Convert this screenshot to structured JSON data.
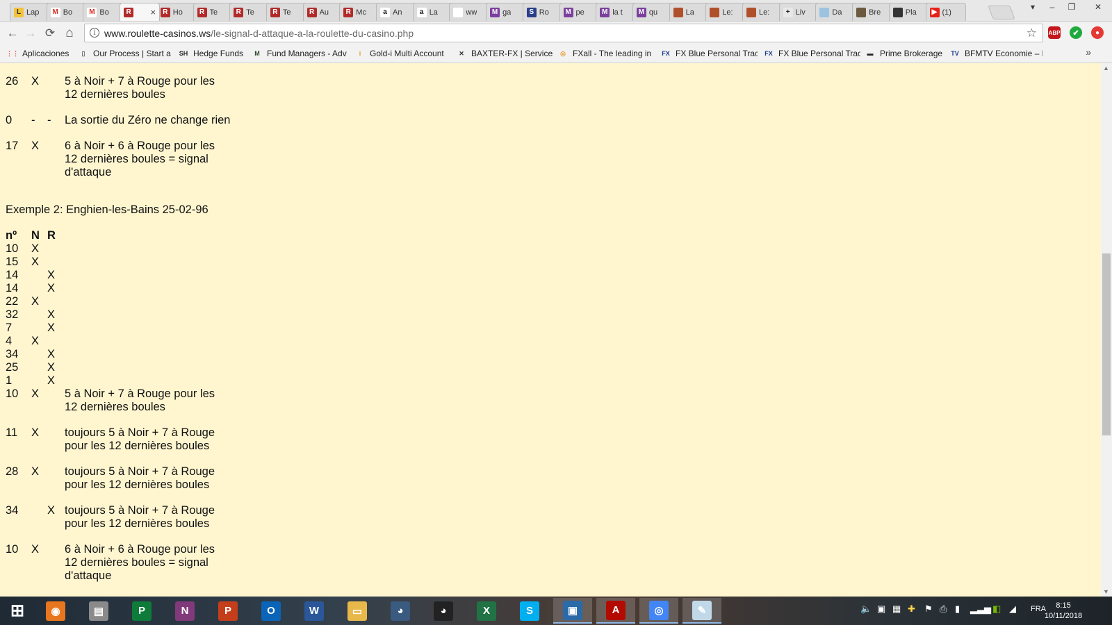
{
  "tabs": [
    {
      "label": "Lap",
      "fav": "L",
      "color": "#f2c33a",
      "text": "#333"
    },
    {
      "label": "Bo",
      "fav": "M",
      "color": "#ffffff",
      "text": "#d93025"
    },
    {
      "label": "Bo",
      "fav": "M",
      "color": "#ffffff",
      "text": "#d93025"
    },
    {
      "label": "",
      "fav": "R",
      "color": "#b22b2b",
      "text": "#fff",
      "active": true,
      "close": "×"
    },
    {
      "label": "Ho",
      "fav": "R",
      "color": "#b22b2b",
      "text": "#fff"
    },
    {
      "label": "Te",
      "fav": "R",
      "color": "#b22b2b",
      "text": "#fff"
    },
    {
      "label": "Te",
      "fav": "R",
      "color": "#b22b2b",
      "text": "#fff"
    },
    {
      "label": "Te",
      "fav": "R",
      "color": "#b22b2b",
      "text": "#fff"
    },
    {
      "label": "Au",
      "fav": "R",
      "color": "#b22b2b",
      "text": "#fff"
    },
    {
      "label": "Mc",
      "fav": "R",
      "color": "#b22b2b",
      "text": "#fff"
    },
    {
      "label": "An",
      "fav": "a",
      "color": "#ffffff",
      "text": "#111"
    },
    {
      "label": "La",
      "fav": "a",
      "color": "#ffffff",
      "text": "#111"
    },
    {
      "label": "ww",
      "fav": "",
      "color": "#ffffff",
      "text": "#111"
    },
    {
      "label": "ga",
      "fav": "M",
      "color": "#7b3f9e",
      "text": "#fff"
    },
    {
      "label": "Ro",
      "fav": "S",
      "color": "#2b3e8c",
      "text": "#fff"
    },
    {
      "label": "pe",
      "fav": "M",
      "color": "#7b3f9e",
      "text": "#fff"
    },
    {
      "label": "la t",
      "fav": "M",
      "color": "#7b3f9e",
      "text": "#fff"
    },
    {
      "label": "qu",
      "fav": "M",
      "color": "#7b3f9e",
      "text": "#fff"
    },
    {
      "label": "La",
      "fav": "",
      "color": "#b0502a",
      "text": "#fff"
    },
    {
      "label": "Le:",
      "fav": "",
      "color": "#b0502a",
      "text": "#fff"
    },
    {
      "label": "Le:",
      "fav": "",
      "color": "#b0502a",
      "text": "#fff"
    },
    {
      "label": "Liv",
      "fav": "+",
      "color": "#e8e8e8",
      "text": "#222"
    },
    {
      "label": "Da",
      "fav": "",
      "color": "#9cc3e0",
      "text": "#fff"
    },
    {
      "label": "Bre",
      "fav": "",
      "color": "#6b5a3e",
      "text": "#fff"
    },
    {
      "label": "Pla",
      "fav": "",
      "color": "#333333",
      "text": "#fff"
    },
    {
      "label": "(1)",
      "fav": "▶",
      "color": "#e62117",
      "text": "#fff"
    }
  ],
  "window": {
    "minimize": "–",
    "restore": "❐",
    "close": "✕",
    "user": "▾"
  },
  "toolbar": {
    "back": "←",
    "forward": "→",
    "reload": "⟳",
    "home": "⌂",
    "info": "i",
    "url_host": "www.roulette-casinos.ws",
    "url_path": "/le-signal-d-attaque-a-la-roulette-du-casino.php",
    "star": "☆",
    "ext_abp": "ABP",
    "ext_check": "✔",
    "ext_red": "●",
    "menu": "⋮"
  },
  "bookmarks": [
    {
      "label": "Aplicaciones",
      "ico": "⋮⋮",
      "color": "#e04a2e"
    },
    {
      "label": "Our Process | Start a",
      "ico": "▯",
      "color": "#666"
    },
    {
      "label": "Hedge Funds",
      "ico": "SH",
      "color": "#222"
    },
    {
      "label": "Fund Managers - Adv",
      "ico": "M",
      "color": "#2c4a2c"
    },
    {
      "label": "Gold-i Multi Account",
      "ico": "i",
      "color": "#d9a520"
    },
    {
      "label": "BAXTER-FX | Services",
      "ico": "✕",
      "color": "#333"
    },
    {
      "label": "FXall - The leading in",
      "ico": "◎",
      "color": "#e89a3c"
    },
    {
      "label": "FX Blue Personal Trac",
      "ico": "FX",
      "color": "#1a3a8c"
    },
    {
      "label": "FX Blue Personal Trac",
      "ico": "FX",
      "color": "#1a3a8c"
    },
    {
      "label": "Prime Brokerage",
      "ico": "▬",
      "color": "#222"
    },
    {
      "label": "BFMTV Economie – la",
      "ico": "TV",
      "color": "#1a3a8c"
    }
  ],
  "bookmarks_more": "»",
  "content": {
    "top_rows": [
      {
        "n": "26",
        "b": "X",
        "r": "",
        "note": [
          "5 à Noir + 7 à Rouge pour les",
          "12 dernières boules"
        ]
      },
      {
        "n": "0",
        "b": "-",
        "r": "-",
        "note": [
          "La sortie du Zéro ne change rien"
        ]
      },
      {
        "n": "17",
        "b": "X",
        "r": "",
        "note": [
          "6 à Noir + 6 à Rouge pour les",
          "12 dernières boules = signal",
          "d'attaque"
        ]
      }
    ],
    "example_title": "Exemple 2: Enghien-les-Bains 25-02-96",
    "headers": {
      "n": "nº",
      "b": "N",
      "r": "R"
    },
    "rows": [
      {
        "n": "10",
        "b": "X",
        "r": ""
      },
      {
        "n": "15",
        "b": "X",
        "r": ""
      },
      {
        "n": "14",
        "b": "",
        "r": "X"
      },
      {
        "n": "14",
        "b": "",
        "r": "X"
      },
      {
        "n": "22",
        "b": "X",
        "r": ""
      },
      {
        "n": "32",
        "b": "",
        "r": "X"
      },
      {
        "n": "7",
        "b": "",
        "r": "X"
      },
      {
        "n": "4",
        "b": "X",
        "r": ""
      },
      {
        "n": "34",
        "b": "",
        "r": "X"
      },
      {
        "n": "25",
        "b": "",
        "r": "X"
      },
      {
        "n": "1",
        "b": "",
        "r": "X"
      }
    ],
    "note_rows": [
      {
        "n": "10",
        "b": "X",
        "r": "",
        "note": [
          "5 à Noir + 7 à Rouge pour les",
          "12 dernières boules"
        ]
      },
      {
        "n": "11",
        "b": "X",
        "r": "",
        "note": [
          "toujours 5 à Noir + 7 à Rouge",
          "pour les 12 dernières boules"
        ]
      },
      {
        "n": "28",
        "b": "X",
        "r": "",
        "note": [
          "toujours 5 à Noir + 7 à Rouge",
          "pour les 12 dernières boules"
        ]
      },
      {
        "n": "34",
        "b": "",
        "r": "X",
        "note": [
          "toujours 5 à Noir + 7 à Rouge",
          "pour les 12 dernières boules"
        ]
      },
      {
        "n": "10",
        "b": "X",
        "r": "",
        "note": [
          "6 à Noir + 6 à Rouge pour les",
          "12 dernières boules = signal",
          "d'attaque"
        ]
      }
    ]
  },
  "taskbar": {
    "apps": [
      {
        "name": "start",
        "glyph": "⊞",
        "color": "transparent"
      },
      {
        "name": "firefox",
        "glyph": "◉",
        "color": "#e8761e"
      },
      {
        "name": "notepad",
        "glyph": "▤",
        "color": "#8a8a8a"
      },
      {
        "name": "publisher",
        "glyph": "P",
        "color": "#0f7b3a"
      },
      {
        "name": "onenote",
        "glyph": "N",
        "color": "#80397b"
      },
      {
        "name": "powerpoint",
        "glyph": "P",
        "color": "#c43e1c"
      },
      {
        "name": "outlook",
        "glyph": "O",
        "color": "#0a64b8"
      },
      {
        "name": "word",
        "glyph": "W",
        "color": "#2b579a"
      },
      {
        "name": "file-explorer",
        "glyph": "▭",
        "color": "#e8b84a"
      },
      {
        "name": "owl-app",
        "glyph": "◕",
        "color": "#3a5a80"
      },
      {
        "name": "cat-app",
        "glyph": "◕",
        "color": "#222"
      },
      {
        "name": "excel",
        "glyph": "X",
        "color": "#217346"
      },
      {
        "name": "skype",
        "glyph": "S",
        "color": "#00aff0"
      },
      {
        "name": "remote-app",
        "glyph": "▣",
        "color": "#2a6aa8"
      },
      {
        "name": "acrobat",
        "glyph": "A",
        "color": "#b30b00"
      },
      {
        "name": "chrome",
        "glyph": "◎",
        "color": "#4285f4"
      },
      {
        "name": "paint",
        "glyph": "✎",
        "color": "#c0d8e8"
      }
    ],
    "lang": "FRA",
    "time": "8:15",
    "date": "10/11/2018"
  }
}
